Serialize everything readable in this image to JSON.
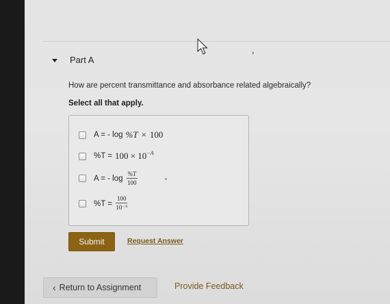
{
  "part": {
    "title": "Part A"
  },
  "question": {
    "text": "How are percent transmittance and absorbance related algebraically?",
    "instruction": "Select all that apply."
  },
  "options": [
    {
      "lhs": "A = - log",
      "expr": "%T",
      "op": "×",
      "rhs": "100"
    },
    {
      "lhs": "%T = ",
      "expr": "100 × 10",
      "exp": "−A"
    },
    {
      "lhs": "A = - log",
      "num": "%T",
      "den": "100"
    },
    {
      "lhs": "%T = ",
      "num": "100",
      "den_base": "10",
      "den_exp": "−A"
    }
  ],
  "buttons": {
    "submit": "Submit",
    "request_answer": "Request Answer",
    "return": "Return to Assignment",
    "feedback": "Provide Feedback"
  },
  "colors": {
    "submit_bg": "#8c6314",
    "link": "#7a5a1a"
  },
  "icons": {
    "collapse": "caret-down-icon",
    "back": "chevron-left-icon",
    "pointer": "mouse-pointer-icon"
  }
}
